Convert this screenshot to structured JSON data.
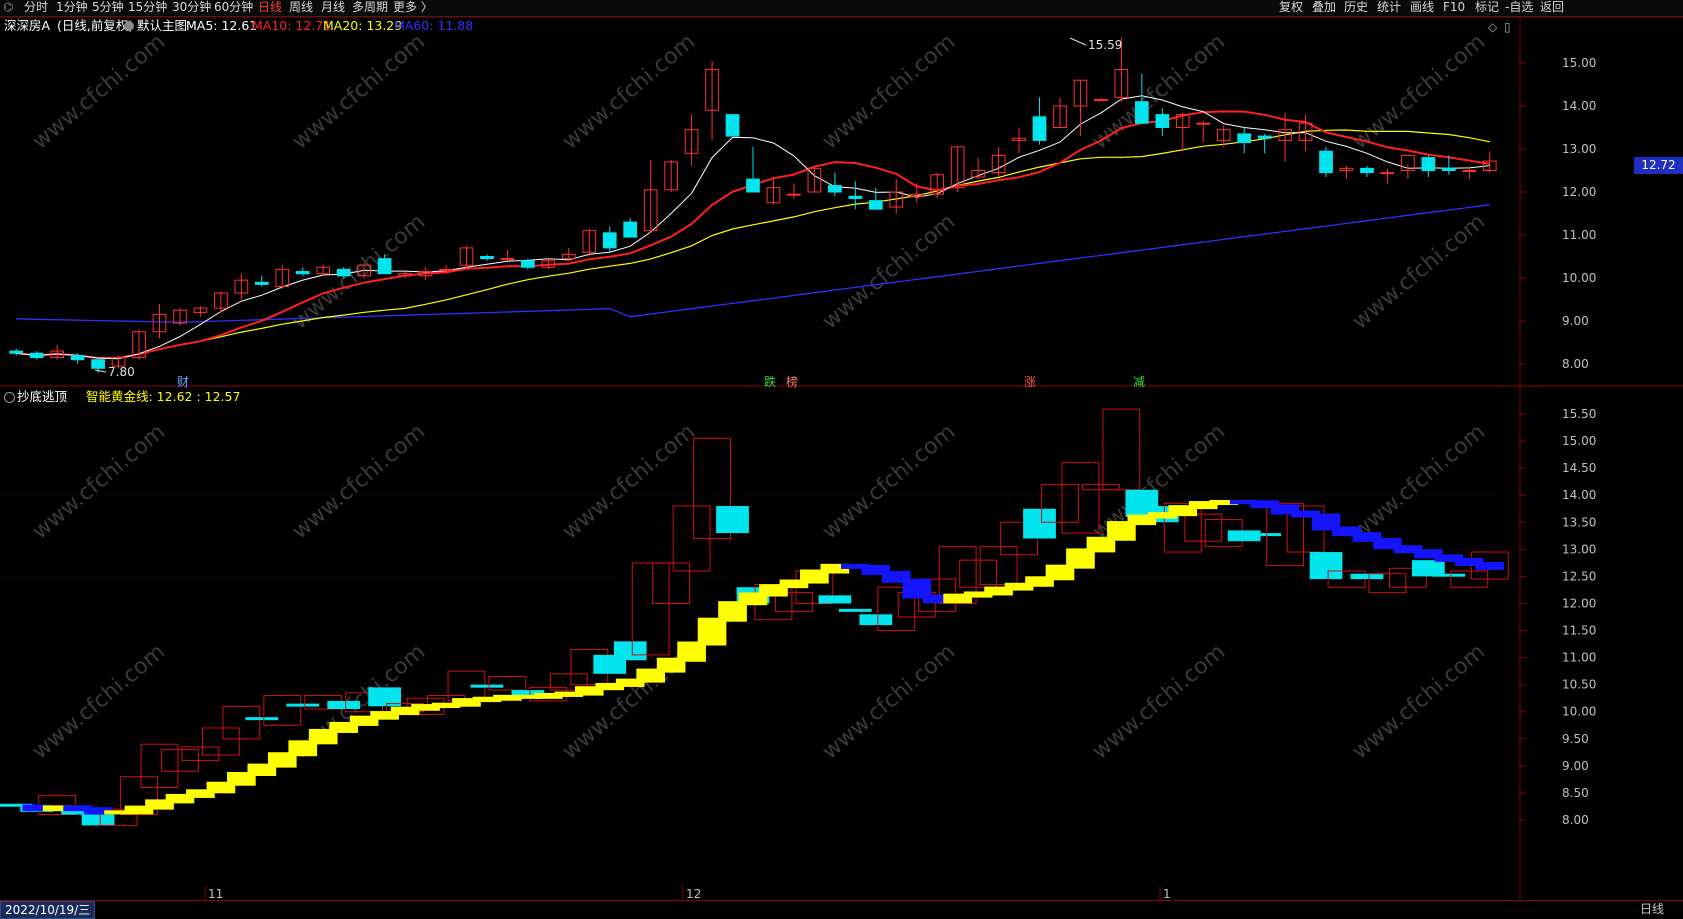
{
  "topbar": {
    "left_icon": "⌬",
    "tabs": [
      {
        "label": "分时",
        "active": false
      },
      {
        "label": "1分钟",
        "active": false
      },
      {
        "label": "5分钟",
        "active": false
      },
      {
        "label": "15分钟",
        "active": false
      },
      {
        "label": "30分钟",
        "active": false
      },
      {
        "label": "60分钟",
        "active": false
      },
      {
        "label": "日线",
        "active": true
      },
      {
        "label": "周线",
        "active": false
      },
      {
        "label": "月线",
        "active": false
      },
      {
        "label": "多周期",
        "active": false
      },
      {
        "label": "更多 〉",
        "active": false
      }
    ],
    "right_buttons": [
      "复权",
      "叠加",
      "历史",
      "统计",
      "画线",
      "F10",
      "标记",
      "-自选",
      "返回"
    ]
  },
  "main_header": {
    "stock": "深深房A",
    "mode": "(日线,前复权)",
    "dropdown_icon": "chevron-down-icon",
    "template": "默认主图",
    "ma5": "MA5: 12.61",
    "ma10": "MA10: 12.71",
    "ma20": "MA20: 13.29",
    "ma60": "MA60: 11.88",
    "colors": {
      "ma5": "#ffffff",
      "ma10": "#ff2020",
      "ma20": "#ffff00",
      "ma60": "#3030ff"
    }
  },
  "sub_header": {
    "indicator": "抄底逃顶",
    "line": "智能黄金线: 12.62 : 12.57"
  },
  "price_badge": "12.72",
  "main_axis": {
    "ticks": [
      "15.00",
      "14.00",
      "13.00",
      "12.00",
      "11.00",
      "10.00",
      "9.00",
      "8.00"
    ]
  },
  "sub_axis": {
    "ticks": [
      "15.50",
      "15.00",
      "14.50",
      "14.00",
      "13.50",
      "13.00",
      "12.50",
      "12.00",
      "11.50",
      "11.00",
      "10.50",
      "10.00",
      "9.50",
      "9.00",
      "8.50",
      "8.00"
    ]
  },
  "annotations": {
    "high": "15.59",
    "low": "7.80",
    "markers": [
      {
        "text": "财",
        "color": "#66aaff"
      },
      {
        "text": "跌",
        "color": "#33dd33"
      },
      {
        "text": "榜",
        "color": "#ff7777"
      },
      {
        "text": "涨",
        "color": "#ff5555"
      },
      {
        "text": "减",
        "color": "#33dd33"
      }
    ]
  },
  "x_axis": {
    "date_label": "2022/10/19/三",
    "month_marks": [
      "11",
      "12",
      "1"
    ],
    "period": "日线"
  },
  "watermark": "www.cfchi.com",
  "chart_data": {
    "type": "candlestick",
    "ylim": [
      7.5,
      15.8
    ],
    "candles": [
      [
        8.3,
        8.35,
        8.2,
        8.25
      ],
      [
        8.25,
        8.3,
        8.1,
        8.15
      ],
      [
        8.15,
        8.45,
        8.1,
        8.3
      ],
      [
        8.2,
        8.25,
        8.0,
        8.1
      ],
      [
        8.1,
        8.15,
        7.8,
        7.9
      ],
      [
        7.95,
        8.2,
        7.9,
        8.15
      ],
      [
        8.15,
        8.8,
        8.1,
        8.75
      ],
      [
        8.75,
        9.4,
        8.6,
        9.15
      ],
      [
        8.95,
        9.3,
        8.9,
        9.25
      ],
      [
        9.2,
        9.35,
        9.1,
        9.3
      ],
      [
        9.3,
        9.7,
        9.2,
        9.65
      ],
      [
        9.65,
        10.1,
        9.5,
        9.95
      ],
      [
        9.9,
        10.05,
        9.8,
        9.85
      ],
      [
        9.8,
        10.3,
        9.75,
        10.2
      ],
      [
        10.15,
        10.25,
        10.05,
        10.1
      ],
      [
        10.1,
        10.3,
        10.05,
        10.25
      ],
      [
        10.2,
        10.25,
        10.0,
        10.05
      ],
      [
        10.05,
        10.35,
        10.0,
        10.3
      ],
      [
        10.45,
        10.55,
        10.1,
        10.1
      ],
      [
        10.05,
        10.15,
        10.0,
        10.1
      ],
      [
        10.05,
        10.25,
        9.95,
        10.15
      ],
      [
        10.2,
        10.3,
        10.1,
        10.2
      ],
      [
        10.3,
        10.75,
        10.2,
        10.7
      ],
      [
        10.5,
        10.55,
        10.4,
        10.45
      ],
      [
        10.45,
        10.65,
        10.4,
        10.45
      ],
      [
        10.4,
        10.45,
        10.2,
        10.25
      ],
      [
        10.25,
        10.45,
        10.2,
        10.4
      ],
      [
        10.45,
        10.7,
        10.4,
        10.55
      ],
      [
        10.6,
        11.15,
        10.5,
        11.1
      ],
      [
        11.05,
        11.2,
        10.6,
        10.7
      ],
      [
        11.3,
        11.4,
        10.95,
        10.95
      ],
      [
        11.1,
        12.75,
        11.05,
        12.05
      ],
      [
        12.05,
        12.75,
        12.0,
        12.7
      ],
      [
        12.9,
        13.8,
        12.6,
        13.45
      ],
      [
        13.9,
        15.05,
        13.2,
        14.85
      ],
      [
        13.8,
        13.8,
        13.3,
        13.3
      ],
      [
        12.3,
        13.05,
        12.0,
        12.0
      ],
      [
        11.75,
        12.35,
        11.7,
        12.1
      ],
      [
        11.95,
        12.2,
        11.85,
        11.95
      ],
      [
        12.0,
        12.6,
        12.0,
        12.55
      ],
      [
        12.15,
        12.45,
        11.9,
        12.0
      ],
      [
        11.9,
        12.25,
        11.6,
        11.85
      ],
      [
        11.8,
        12.1,
        11.65,
        11.6
      ],
      [
        11.65,
        12.3,
        11.5,
        12.0
      ],
      [
        11.9,
        12.2,
        11.75,
        11.95
      ],
      [
        11.95,
        12.45,
        11.85,
        12.4
      ],
      [
        12.1,
        13.05,
        12.0,
        13.05
      ],
      [
        12.35,
        12.8,
        12.3,
        12.5
      ],
      [
        12.45,
        13.05,
        12.35,
        12.85
      ],
      [
        13.2,
        13.5,
        12.9,
        13.25
      ],
      [
        13.75,
        14.2,
        13.1,
        13.2
      ],
      [
        13.5,
        14.2,
        13.5,
        14.0
      ],
      [
        14.0,
        14.6,
        13.3,
        14.6
      ],
      [
        14.15,
        14.2,
        14.1,
        14.15
      ],
      [
        14.2,
        15.59,
        14.1,
        14.85
      ],
      [
        14.1,
        14.75,
        13.6,
        13.6
      ],
      [
        13.8,
        13.95,
        13.3,
        13.5
      ],
      [
        13.5,
        13.85,
        12.95,
        13.8
      ],
      [
        13.6,
        13.65,
        13.15,
        13.6
      ],
      [
        13.2,
        13.55,
        13.05,
        13.45
      ],
      [
        13.35,
        13.5,
        12.9,
        13.15
      ],
      [
        13.3,
        13.35,
        12.9,
        13.25
      ],
      [
        13.2,
        13.85,
        12.7,
        13.45
      ],
      [
        13.2,
        13.8,
        12.95,
        13.6
      ],
      [
        12.95,
        13.05,
        12.35,
        12.45
      ],
      [
        12.5,
        12.6,
        12.3,
        12.55
      ],
      [
        12.55,
        12.6,
        12.35,
        12.45
      ],
      [
        12.45,
        12.55,
        12.2,
        12.45
      ],
      [
        12.5,
        12.65,
        12.3,
        12.85
      ],
      [
        12.8,
        12.85,
        12.35,
        12.5
      ],
      [
        12.55,
        12.85,
        12.4,
        12.5
      ],
      [
        12.5,
        12.6,
        12.3,
        12.5
      ],
      [
        12.5,
        12.95,
        12.45,
        12.72
      ]
    ],
    "ma5_color": "#ffffff",
    "ma10_color": "#ff2020",
    "ma20_color": "#ffff00",
    "ma60_color": "#3030ff"
  }
}
